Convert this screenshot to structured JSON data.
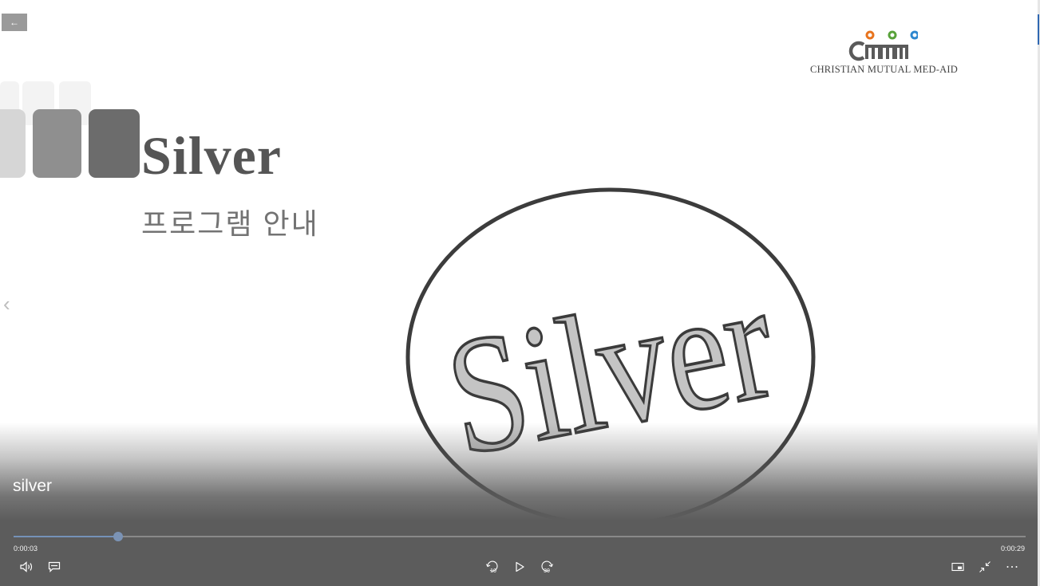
{
  "nav": {
    "back_symbol": "←"
  },
  "logo": {
    "text": "CHRISTIAN MUTUAL MED-AID",
    "dot_colors": [
      "#e8741e",
      "#58a23a",
      "#2d87cf"
    ]
  },
  "slide": {
    "title": "Silver",
    "subtitle": "프로그램 안내",
    "emblem_text": "Silver"
  },
  "player": {
    "video_title": "silver",
    "current_time": "0:00:03",
    "duration": "0:00:29",
    "progress_fraction": 0.1034,
    "skip_back_seconds": "10",
    "skip_forward_seconds": "30",
    "accent_color": "#7592b8"
  },
  "icons": {
    "back": "arrow-left-icon",
    "previous": "chevron-left-icon",
    "volume": "volume-icon",
    "captions": "captions-icon",
    "skip_back": "skip-back-10-icon",
    "play": "play-icon",
    "skip_forward": "skip-forward-30-icon",
    "mini_view": "mini-view-icon",
    "exit_fullscreen": "exit-fullscreen-icon",
    "more": "more-icon"
  }
}
